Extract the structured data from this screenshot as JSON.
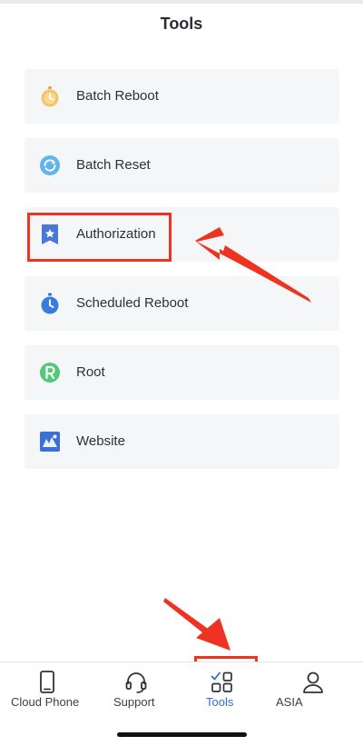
{
  "header": {
    "title": "Tools"
  },
  "tools": [
    {
      "label": "Batch Reboot",
      "icon": "stopwatch-icon"
    },
    {
      "label": "Batch Reset",
      "icon": "refresh-icon"
    },
    {
      "label": "Authorization",
      "icon": "bookmark-star-icon"
    },
    {
      "label": "Scheduled Reboot",
      "icon": "timer-icon"
    },
    {
      "label": "Root",
      "icon": "root-r-icon"
    },
    {
      "label": "Website",
      "icon": "website-icon"
    }
  ],
  "tabs": [
    {
      "label": "Cloud Phone",
      "icon": "phone-icon"
    },
    {
      "label": "Support",
      "icon": "headset-icon"
    },
    {
      "label": "Tools",
      "icon": "tools-grid-icon",
      "active": true
    },
    {
      "label": "ASIA",
      "icon": "user-icon"
    }
  ],
  "colors": {
    "accent": "#2f6fd6",
    "annotation": "#ee3322",
    "item_background": "#f5f6f8"
  }
}
